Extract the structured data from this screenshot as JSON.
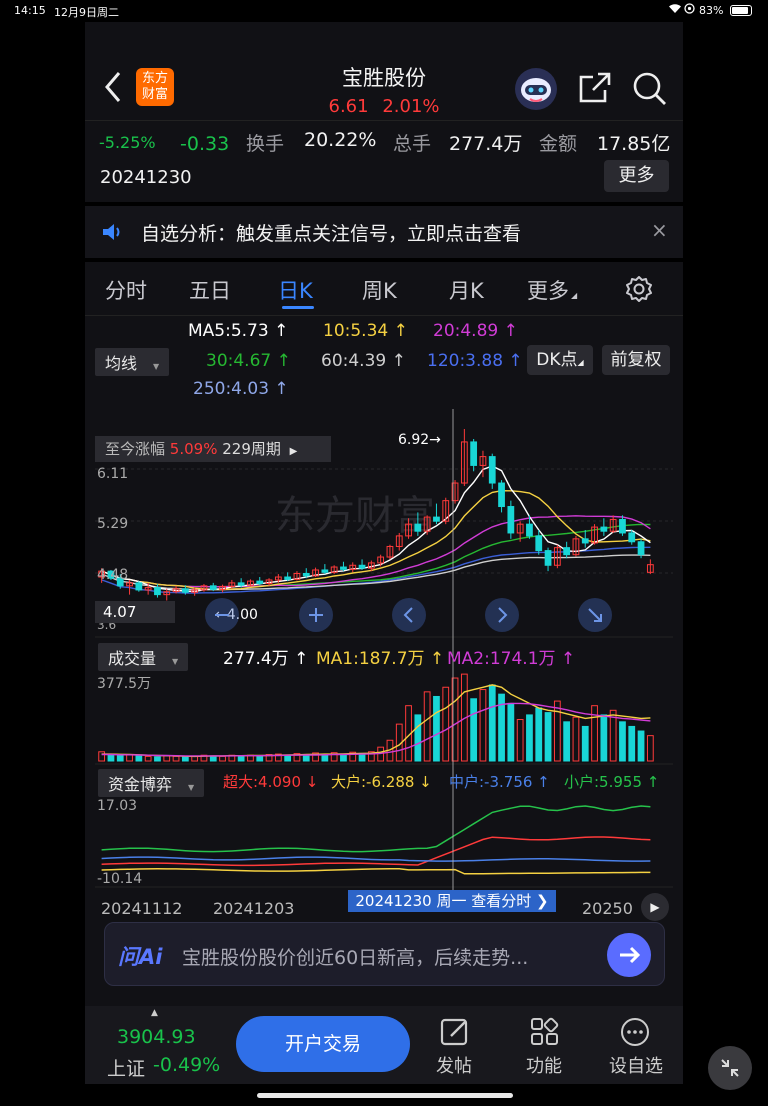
{
  "status_bar": {
    "time": "14:15",
    "date": "12月9日周二",
    "battery": "83%"
  },
  "header": {
    "title": "宝胜股份",
    "price": "6.61",
    "change_pct": "2.01%",
    "logo_line1": "东方",
    "logo_line2": "财富"
  },
  "quote": {
    "amplitude_a": "-5.25%",
    "change": "-0.33",
    "turnover_label": "换手",
    "turnover": "20.22%",
    "volume_label": "总手",
    "volume": "277.4万",
    "amount_label": "金额",
    "amount": "17.85亿",
    "date": "20241230",
    "more_label": "更多"
  },
  "notice": {
    "text": "自选分析：触发重点关注信号，立即点击查看",
    "close": "×"
  },
  "tabs": [
    "分时",
    "五日",
    "日K",
    "周K",
    "月K",
    "更多"
  ],
  "ma": {
    "dropdown": "均线",
    "ma5": "MA5:5.73 ↑",
    "ma10": "10:5.34 ↑",
    "ma20": "20:4.89 ↑",
    "ma30": "30:4.67 ↑",
    "ma60": "60:4.39 ↑",
    "ma120": "120:3.88 ↑",
    "ma250": "250:4.03 ↑",
    "dk_label": "DK点",
    "adjust_label": "前复权"
  },
  "kline": {
    "gain_label": "至今涨幅",
    "gain_value": "5.09%",
    "period": "229周期",
    "y_high": "6.11",
    "y_mid": "5.29",
    "y_low1": "4.48",
    "y_low2": "3.6",
    "max_label": "6.92→",
    "min_label": "←4.00",
    "cursor_price": "4.07",
    "watermark": "东方财富"
  },
  "volume": {
    "dropdown": "成交量",
    "value": "277.4万 ↑",
    "ma1": "MA1:187.7万 ↑",
    "ma2": "MA2:174.1万 ↑",
    "y_max": "377.5万"
  },
  "capital": {
    "dropdown": "资金博弈",
    "super": "超大:4.090 ↓",
    "large": "大户:-6.288 ↓",
    "medium": "中户:-3.756 ↑",
    "small": "小户:5.955 ↑",
    "y_max": "17.03",
    "y_min": "-10.14"
  },
  "x_axis": {
    "d1": "20241112",
    "d2": "20241203",
    "cursor": "20241230 周一 查看分时 ❯",
    "d3": "20250"
  },
  "ai": {
    "logo": "问Ai",
    "text": "宝胜股份股价创近60日新高，后续走势..."
  },
  "bottom": {
    "index_value": "3904.93",
    "index_name": "上证",
    "index_change": "-0.49%",
    "open_account": "开户交易",
    "post": "发帖",
    "functions": "功能",
    "set_fav": "设自选"
  },
  "colors": {
    "up": "#ff3a3a",
    "down": "#19d6d6",
    "ma5": "#ffffff",
    "ma10": "#f5d142",
    "ma20": "#d13cd6",
    "ma30": "#26b832",
    "ma60": "#cfcfcf",
    "ma120": "#3a5ed6",
    "ma250": "#8fa7e8"
  },
  "chart_data": {
    "type": "candlestick",
    "title": "",
    "ylim": [
      3.6,
      6.92
    ],
    "candles": [
      [
        4.4,
        4.55,
        4.3,
        4.5
      ],
      [
        4.5,
        4.52,
        4.35,
        4.38
      ],
      [
        4.38,
        4.45,
        4.2,
        4.25
      ],
      [
        4.25,
        4.35,
        4.1,
        4.3
      ],
      [
        4.3,
        4.33,
        4.15,
        4.18
      ],
      [
        4.18,
        4.3,
        4.1,
        4.22
      ],
      [
        4.22,
        4.28,
        4.05,
        4.1
      ],
      [
        4.1,
        4.2,
        4.0,
        4.15
      ],
      [
        4.15,
        4.25,
        4.12,
        4.2
      ],
      [
        4.2,
        4.26,
        4.1,
        4.14
      ],
      [
        4.14,
        4.22,
        4.08,
        4.18
      ],
      [
        4.18,
        4.28,
        4.15,
        4.25
      ],
      [
        4.25,
        4.3,
        4.16,
        4.19
      ],
      [
        4.19,
        4.27,
        4.14,
        4.24
      ],
      [
        4.24,
        4.35,
        4.2,
        4.3
      ],
      [
        4.3,
        4.38,
        4.22,
        4.26
      ],
      [
        4.26,
        4.36,
        4.24,
        4.33
      ],
      [
        4.33,
        4.4,
        4.26,
        4.29
      ],
      [
        4.29,
        4.38,
        4.25,
        4.35
      ],
      [
        4.35,
        4.45,
        4.3,
        4.4
      ],
      [
        4.4,
        4.48,
        4.33,
        4.36
      ],
      [
        4.36,
        4.5,
        4.34,
        4.46
      ],
      [
        4.46,
        4.55,
        4.38,
        4.42
      ],
      [
        4.42,
        4.56,
        4.4,
        4.52
      ],
      [
        4.52,
        4.62,
        4.45,
        4.48
      ],
      [
        4.48,
        4.6,
        4.45,
        4.57
      ],
      [
        4.57,
        4.66,
        4.5,
        4.53
      ],
      [
        4.53,
        4.65,
        4.48,
        4.6
      ],
      [
        4.6,
        4.7,
        4.52,
        4.55
      ],
      [
        4.55,
        4.68,
        4.5,
        4.64
      ],
      [
        4.64,
        4.78,
        4.58,
        4.74
      ],
      [
        4.74,
        4.95,
        4.7,
        4.92
      ],
      [
        4.92,
        5.15,
        4.85,
        5.1
      ],
      [
        5.1,
        5.4,
        5.05,
        5.3
      ],
      [
        5.3,
        5.5,
        5.1,
        5.18
      ],
      [
        5.18,
        5.45,
        5.12,
        5.42
      ],
      [
        5.42,
        5.65,
        5.3,
        5.35
      ],
      [
        5.35,
        5.75,
        5.3,
        5.7
      ],
      [
        5.7,
        6.05,
        5.65,
        6.0
      ],
      [
        6.0,
        6.92,
        5.95,
        6.7
      ],
      [
        6.7,
        6.75,
        6.2,
        6.3
      ],
      [
        6.3,
        6.55,
        6.1,
        6.45
      ],
      [
        6.45,
        6.5,
        5.9,
        6.0
      ],
      [
        6.0,
        6.05,
        5.5,
        5.6
      ],
      [
        5.6,
        5.7,
        5.05,
        5.15
      ],
      [
        5.15,
        5.35,
        5.0,
        5.3
      ],
      [
        5.3,
        5.45,
        5.05,
        5.1
      ],
      [
        5.1,
        5.2,
        4.78,
        4.85
      ],
      [
        4.85,
        4.9,
        4.5,
        4.6
      ],
      [
        4.6,
        4.95,
        4.55,
        4.9
      ],
      [
        4.9,
        5.0,
        4.72,
        4.78
      ],
      [
        4.78,
        5.1,
        4.75,
        5.05
      ],
      [
        5.05,
        5.2,
        4.9,
        4.98
      ],
      [
        4.98,
        5.3,
        4.95,
        5.25
      ],
      [
        5.25,
        5.4,
        5.1,
        5.18
      ],
      [
        5.18,
        5.45,
        5.15,
        5.38
      ],
      [
        5.38,
        5.45,
        5.1,
        5.15
      ],
      [
        5.15,
        5.2,
        4.95,
        5.0
      ],
      [
        5.0,
        5.05,
        4.72,
        4.78
      ],
      [
        4.48,
        4.7,
        4.45,
        4.61
      ]
    ],
    "volume": [
      40,
      30,
      25,
      28,
      22,
      20,
      18,
      22,
      20,
      18,
      20,
      25,
      22,
      20,
      25,
      23,
      25,
      22,
      28,
      30,
      26,
      32,
      28,
      35,
      30,
      36,
      30,
      38,
      33,
      40,
      60,
      90,
      160,
      240,
      200,
      300,
      280,
      320,
      360,
      377,
      270,
      310,
      330,
      290,
      250,
      180,
      200,
      230,
      210,
      260,
      170,
      190,
      150,
      240,
      200,
      220,
      170,
      150,
      130,
      110
    ],
    "ma1": [
      30,
      30,
      29,
      28,
      27,
      25,
      24,
      23,
      22,
      21,
      20,
      21,
      22,
      22,
      23,
      23,
      24,
      24,
      24,
      25,
      26,
      27,
      28,
      29,
      30,
      30,
      31,
      32,
      33,
      34,
      38,
      48,
      70,
      110,
      150,
      180,
      210,
      230,
      260,
      300,
      310,
      320,
      330,
      320,
      290,
      270,
      250,
      230,
      220,
      215,
      205,
      195,
      185,
      190,
      195,
      200,
      195,
      190,
      185,
      187
    ],
    "ma2": [
      28,
      28,
      27,
      27,
      26,
      25,
      24,
      24,
      23,
      22,
      22,
      22,
      22,
      22,
      22,
      23,
      23,
      23,
      24,
      24,
      25,
      25,
      26,
      26,
      27,
      28,
      28,
      29,
      30,
      31,
      33,
      38,
      46,
      58,
      75,
      95,
      115,
      135,
      160,
      185,
      205,
      220,
      235,
      245,
      250,
      250,
      248,
      243,
      236,
      230,
      222,
      212,
      205,
      200,
      195,
      190,
      185,
      182,
      178,
      174
    ]
  }
}
